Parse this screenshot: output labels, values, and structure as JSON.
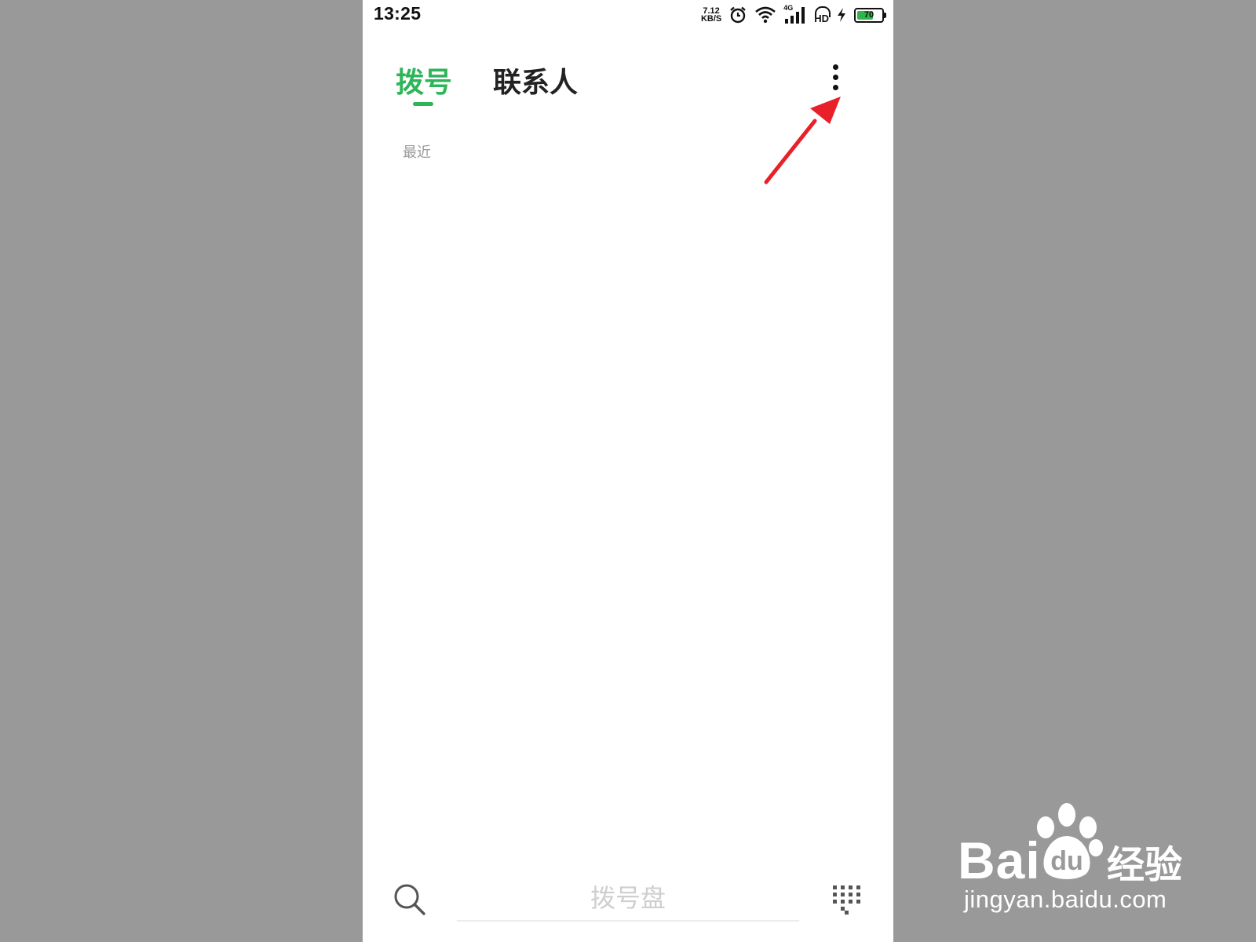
{
  "status_bar": {
    "time": "13:25",
    "net_speed_value": "7.12",
    "net_speed_unit": "KB/S",
    "network_type": "4G",
    "hd_label": "HD",
    "battery_level": "70",
    "icons": [
      "alarm-icon",
      "wifi-icon",
      "cellular-signal-icon",
      "hd-voice-icon",
      "charging-icon",
      "battery-icon"
    ]
  },
  "tabs": {
    "active": "拨号",
    "items": [
      {
        "label": "拨号"
      },
      {
        "label": "联系人"
      }
    ]
  },
  "menu": {
    "icon": "more-vertical-icon"
  },
  "call_log": {
    "section_label": "最近"
  },
  "bottom_bar": {
    "search_icon": "search-icon",
    "dialpad_placeholder": "拨号盘",
    "keypad_icon": "dialpad-grid-icon"
  },
  "colors": {
    "accent": "#2fb559",
    "annotation_arrow": "#e8202a",
    "outer_background": "#999999",
    "battery_fill": "#32b44a"
  },
  "watermark": {
    "brand": "Bai",
    "brand_du": "du",
    "brand_cn": "经验",
    "url": "jingyan.baidu.com"
  }
}
